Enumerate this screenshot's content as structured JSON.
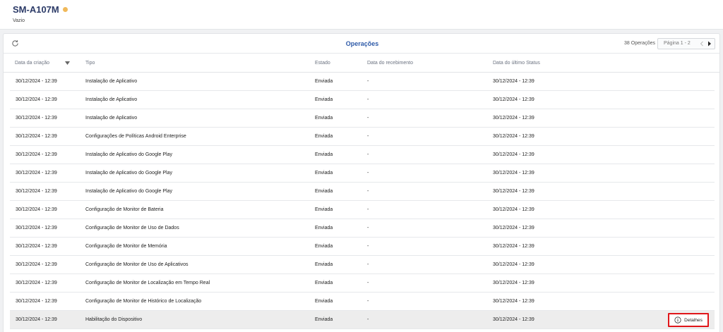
{
  "device": {
    "name": "SM-A107M",
    "subtitle": "Vazio",
    "status_color": "#f0b95a"
  },
  "panel": {
    "title": "Operações",
    "count": "38 Operações",
    "pagination_label": "Página 1 - 2",
    "title_color": "#2e5aa8"
  },
  "columns": {
    "date": "Data da criação",
    "tipo": "Tipo",
    "estado": "Estado",
    "recebimento": "Data do recebimento",
    "ultimo_status": "Data do último Status"
  },
  "rows": [
    {
      "date": "30/12/2024 - 12:39",
      "tipo": "Instalação de Aplicativo",
      "estado": "Enviada",
      "recebimento": "-",
      "status": "30/12/2024 - 12:39"
    },
    {
      "date": "30/12/2024 - 12:39",
      "tipo": "Instalação de Aplicativo",
      "estado": "Enviada",
      "recebimento": "-",
      "status": "30/12/2024 - 12:39"
    },
    {
      "date": "30/12/2024 - 12:39",
      "tipo": "Instalação de Aplicativo",
      "estado": "Enviada",
      "recebimento": "-",
      "status": "30/12/2024 - 12:39"
    },
    {
      "date": "30/12/2024 - 12:39",
      "tipo": "Configurações de Políticas Android Enterprise",
      "estado": "Enviada",
      "recebimento": "-",
      "status": "30/12/2024 - 12:39"
    },
    {
      "date": "30/12/2024 - 12:39",
      "tipo": "Instalação de Aplicativo do Google Play",
      "estado": "Enviada",
      "recebimento": "-",
      "status": "30/12/2024 - 12:39"
    },
    {
      "date": "30/12/2024 - 12:39",
      "tipo": "Instalação de Aplicativo do Google Play",
      "estado": "Enviada",
      "recebimento": "-",
      "status": "30/12/2024 - 12:39"
    },
    {
      "date": "30/12/2024 - 12:39",
      "tipo": "Instalação de Aplicativo do Google Play",
      "estado": "Enviada",
      "recebimento": "-",
      "status": "30/12/2024 - 12:39"
    },
    {
      "date": "30/12/2024 - 12:39",
      "tipo": "Configuração de Monitor de Bateria",
      "estado": "Enviada",
      "recebimento": "-",
      "status": "30/12/2024 - 12:39"
    },
    {
      "date": "30/12/2024 - 12:39",
      "tipo": "Configuração de Monitor de Uso de Dados",
      "estado": "Enviada",
      "recebimento": "-",
      "status": "30/12/2024 - 12:39"
    },
    {
      "date": "30/12/2024 - 12:39",
      "tipo": "Configuração de Monitor de Memória",
      "estado": "Enviada",
      "recebimento": "-",
      "status": "30/12/2024 - 12:39"
    },
    {
      "date": "30/12/2024 - 12:39",
      "tipo": "Configuração de Monitor de Uso de Aplicativos",
      "estado": "Enviada",
      "recebimento": "-",
      "status": "30/12/2024 - 12:39"
    },
    {
      "date": "30/12/2024 - 12:39",
      "tipo": "Configuração de Monitor de Localização em Tempo Real",
      "estado": "Enviada",
      "recebimento": "-",
      "status": "30/12/2024 - 12:39"
    },
    {
      "date": "30/12/2024 - 12:39",
      "tipo": "Configuração de Monitor de Histórico de Localização",
      "estado": "Enviada",
      "recebimento": "-",
      "status": "30/12/2024 - 12:39"
    },
    {
      "date": "30/12/2024 - 12:39",
      "tipo": "Habilitação do Dispositivo",
      "estado": "Enviada",
      "recebimento": "-",
      "status": "30/12/2024 - 12:39",
      "details_label": "Detalhes"
    }
  ],
  "icons": {
    "refresh": "refresh-icon",
    "sort": "sort-down-icon",
    "prev": "chevron-left-icon",
    "next": "chevron-right-icon",
    "info": "info-icon"
  }
}
